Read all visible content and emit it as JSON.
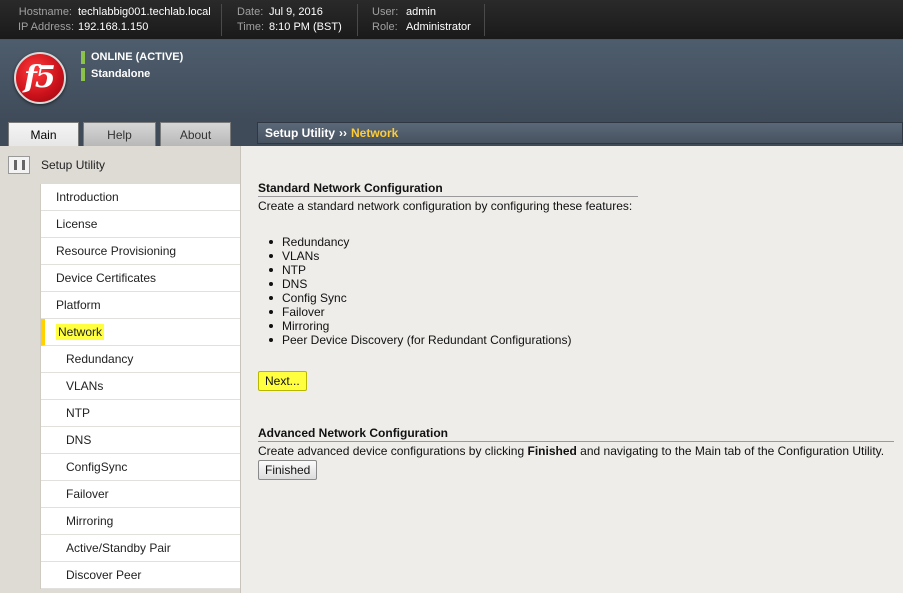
{
  "topbar": {
    "hostname_label": "Hostname:",
    "hostname": "techlabbig001.techlab.local",
    "ip_label": "IP Address:",
    "ip": "192.168.1.150",
    "date_label": "Date:",
    "date": "Jul 9, 2016",
    "time_label": "Time:",
    "time": "8:10 PM (BST)",
    "user_label": "User:",
    "user": "admin",
    "role_label": "Role:",
    "role": "Administrator"
  },
  "header": {
    "logo_text": "f5",
    "status_online": "ONLINE (ACTIVE)",
    "status_mode": "Standalone",
    "status_color": "#8bc34a"
  },
  "tabs": [
    {
      "label": "Main",
      "active": true
    },
    {
      "label": "Help",
      "active": false
    },
    {
      "label": "About",
      "active": false
    }
  ],
  "breadcrumb": {
    "parent": "Setup Utility",
    "separator": "››",
    "current": "Network",
    "current_color": "#ffcc33"
  },
  "sidebar": {
    "title": "Setup Utility",
    "items": [
      {
        "label": "Introduction"
      },
      {
        "label": "License"
      },
      {
        "label": "Resource Provisioning"
      },
      {
        "label": "Device Certificates"
      },
      {
        "label": "Platform"
      },
      {
        "label": "Network"
      },
      {
        "label": "Redundancy"
      },
      {
        "label": "VLANs"
      },
      {
        "label": "NTP"
      },
      {
        "label": "DNS"
      },
      {
        "label": "ConfigSync"
      },
      {
        "label": "Failover"
      },
      {
        "label": "Mirroring"
      },
      {
        "label": "Active/Standby Pair"
      },
      {
        "label": "Discover Peer"
      }
    ]
  },
  "standard": {
    "title": "Standard Network Configuration",
    "description": "Create a standard network configuration by configuring these features:",
    "features": [
      "Redundancy",
      "VLANs",
      "NTP",
      "DNS",
      "Config Sync",
      "Failover",
      "Mirroring",
      "Peer Device Discovery (for Redundant Configurations)"
    ],
    "next_label": "Next..."
  },
  "advanced": {
    "title": "Advanced Network Configuration",
    "desc_before": "Create advanced device configurations by clicking ",
    "desc_bold": "Finished",
    "desc_after": " and navigating to the Main tab of the Configuration Utility.",
    "finished_label": "Finished"
  },
  "highlight_color": "#ffff40"
}
